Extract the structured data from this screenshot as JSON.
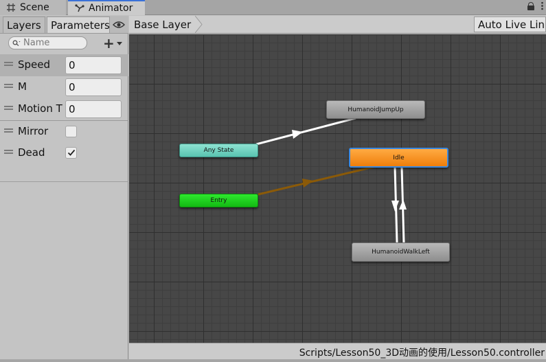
{
  "window_tabs": [
    {
      "label": "Scene",
      "icon": "grid-icon",
      "active": false
    },
    {
      "label": "Animator",
      "icon": "animator-icon",
      "active": true
    }
  ],
  "left_panel": {
    "tabs": [
      {
        "label": "Layers",
        "active": false
      },
      {
        "label": "Parameters",
        "active": true
      }
    ],
    "search": {
      "placeholder": "Name",
      "value": ""
    },
    "parameters": [
      {
        "name": "Speed",
        "type": "float",
        "value": "0",
        "selected": true
      },
      {
        "name": "M",
        "type": "float",
        "value": "0",
        "selected": false
      },
      {
        "name": "Motion T",
        "type": "float",
        "value": "0",
        "selected": false
      },
      {
        "name": "Mirror",
        "type": "bool",
        "checked": false,
        "selected": false
      },
      {
        "name": "Dead",
        "type": "bool",
        "checked": true,
        "selected": false
      }
    ]
  },
  "graph": {
    "breadcrumb": "Base Layer",
    "live_link_label": "Auto Live Link",
    "nodes": {
      "jump": "HumanoidJumpUp",
      "any_state": "Any State",
      "idle": "Idle",
      "entry": "Entry",
      "walk": "HumanoidWalkLeft"
    },
    "colors": {
      "background": "#474747",
      "any_state": "#6fd2c0",
      "entry": "#1ccf1c",
      "idle": "#f7920e",
      "state": "#a3a3a3",
      "selection": "#3a88e0",
      "default_transition": "#8b5a08",
      "transition": "#ffffff"
    },
    "status_path": "Scripts/Lesson50_3D动画的使用/Lesson50.controller"
  }
}
